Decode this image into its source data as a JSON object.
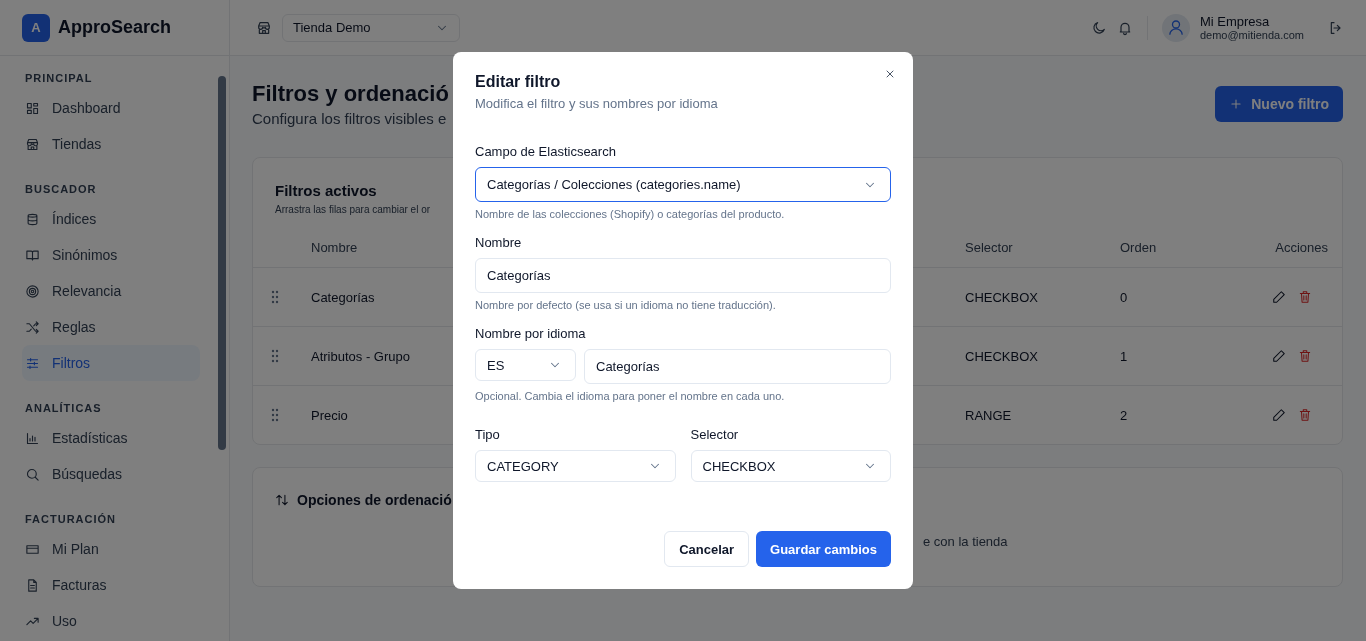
{
  "brand": {
    "logo_letter": "A",
    "name": "ApproSearch"
  },
  "store_select": {
    "value": "Tienda Demo"
  },
  "user": {
    "name": "Mi Empresa",
    "email": "demo@mitienda.com"
  },
  "sidebar": {
    "sections": [
      {
        "title": "PRINCIPAL",
        "items": [
          {
            "label": "Dashboard",
            "selected": false
          },
          {
            "label": "Tiendas",
            "selected": false
          }
        ]
      },
      {
        "title": "BUSCADOR",
        "items": [
          {
            "label": "Índices",
            "selected": false
          },
          {
            "label": "Sinónimos",
            "selected": false
          },
          {
            "label": "Relevancia",
            "selected": false
          },
          {
            "label": "Reglas",
            "selected": false
          },
          {
            "label": "Filtros",
            "selected": true
          }
        ]
      },
      {
        "title": "ANALÍTICAS",
        "items": [
          {
            "label": "Estadísticas",
            "selected": false
          },
          {
            "label": "Búsquedas",
            "selected": false
          }
        ]
      },
      {
        "title": "FACTURACIÓN",
        "items": [
          {
            "label": "Mi Plan",
            "selected": false
          },
          {
            "label": "Facturas",
            "selected": false
          },
          {
            "label": "Uso",
            "selected": false
          }
        ]
      }
    ]
  },
  "page": {
    "title": "Filtros y ordenació",
    "subtitle": "Configura los filtros visibles e",
    "new_button": "Nuevo filtro"
  },
  "filters_card": {
    "title": "Filtros activos",
    "hint": "Arrastra las filas para cambiar el or",
    "columns": [
      "Nombre",
      "Selector",
      "Orden",
      "Acciones"
    ],
    "rows": [
      {
        "name": "Categorías",
        "selector": "CHECKBOX",
        "order": "0"
      },
      {
        "name": "Atributos - Grupo",
        "selector": "CHECKBOX",
        "order": "1"
      },
      {
        "name": "Precio",
        "selector": "RANGE",
        "order": "2"
      }
    ]
  },
  "sort_card": {
    "title": "Opciones de ordenació",
    "text": "e con la tienda"
  },
  "modal": {
    "title": "Editar filtro",
    "subtitle": "Modifica el filtro y sus nombres por idioma",
    "es_field": {
      "label": "Campo de Elasticsearch",
      "value": "Categorías / Colecciones (categories.name)",
      "focused": true,
      "help": "Nombre de las colecciones (Shopify) o categorías del producto."
    },
    "name_field": {
      "label": "Nombre",
      "value": "Categorías",
      "help": "Nombre por defecto (se usa si un idioma no tiene traducción)."
    },
    "lang_field": {
      "label": "Nombre por idioma",
      "language": "ES",
      "value": "Categorías",
      "help": "Opcional. Cambia el idioma para poner el nombre en cada uno."
    },
    "type_field": {
      "label": "Tipo",
      "value": "CATEGORY"
    },
    "selector_field": {
      "label": "Selector",
      "value": "CHECKBOX"
    },
    "cancel": "Cancelar",
    "save": "Guardar cambios"
  }
}
